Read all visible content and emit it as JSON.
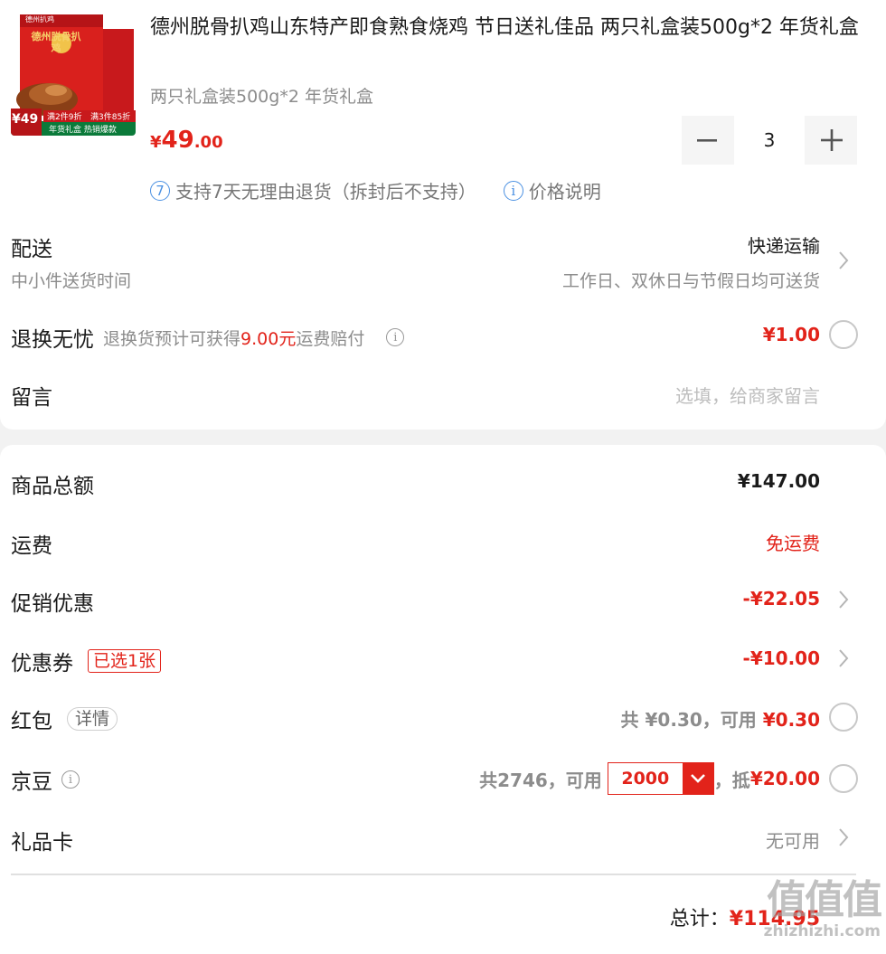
{
  "product": {
    "title": "德州脱骨扒鸡山东特产即食熟食烧鸡 节日送礼佳品 两只礼盒装500g*2 年货礼盒",
    "spec": "两只礼盒装500g*2 年货礼盒",
    "price_currency": "¥",
    "price_int": "49",
    "price_dec": ".00",
    "quantity": "3",
    "image_text": {
      "brand": "德州扒鸡",
      "box_title": "德州脱骨扒鸡",
      "price_badge": "¥49",
      "promo1": "满2件9折",
      "promo2": "满3件85折",
      "bottom_banner": "年货礼盒 热销爆款"
    },
    "service_num": "7",
    "service_text": "支持7天无理由退货（拆封后不支持）",
    "price_explain": "价格说明"
  },
  "delivery": {
    "label": "配送",
    "sub": "中小件送货时间",
    "method": "快递运输",
    "time": "工作日、双休日与节假日均可送货"
  },
  "return_worry": {
    "label": "退换无忧",
    "desc_pre": "退换货预计可获得",
    "desc_amount": "9.00元",
    "desc_post": "运费赔付",
    "price": "¥1.00"
  },
  "message": {
    "label": "留言",
    "placeholder": "选填，给商家留言"
  },
  "summary": {
    "goods_total_label": "商品总额",
    "goods_total": "¥147.00",
    "shipping_label": "运费",
    "shipping": "免运费",
    "promo_label": "促销优惠",
    "promo": "-¥22.05",
    "coupon_label": "优惠券",
    "coupon_tag": "已选1张",
    "coupon": "-¥10.00",
    "redpacket_label": "红包",
    "redpacket_tag": "详情",
    "redpacket_pre": "共 ¥0.30，可用 ",
    "redpacket_avail": "¥0.30",
    "beans_label": "京豆",
    "beans_pre": "共2746，可用",
    "beans_value": "2000",
    "beans_mid": "，抵",
    "beans_deduct": "¥20.00",
    "giftcard_label": "礼品卡",
    "giftcard": "无可用",
    "total_label": "总计：",
    "total": "¥114.95"
  },
  "watermark": {
    "cn": "值值值",
    "url": "zhizhizhi.com"
  },
  "colors": {
    "accent": "#e2231a",
    "info_blue": "#4a90e2",
    "text": "#1a1a1a",
    "muted": "#8c8c8c"
  }
}
